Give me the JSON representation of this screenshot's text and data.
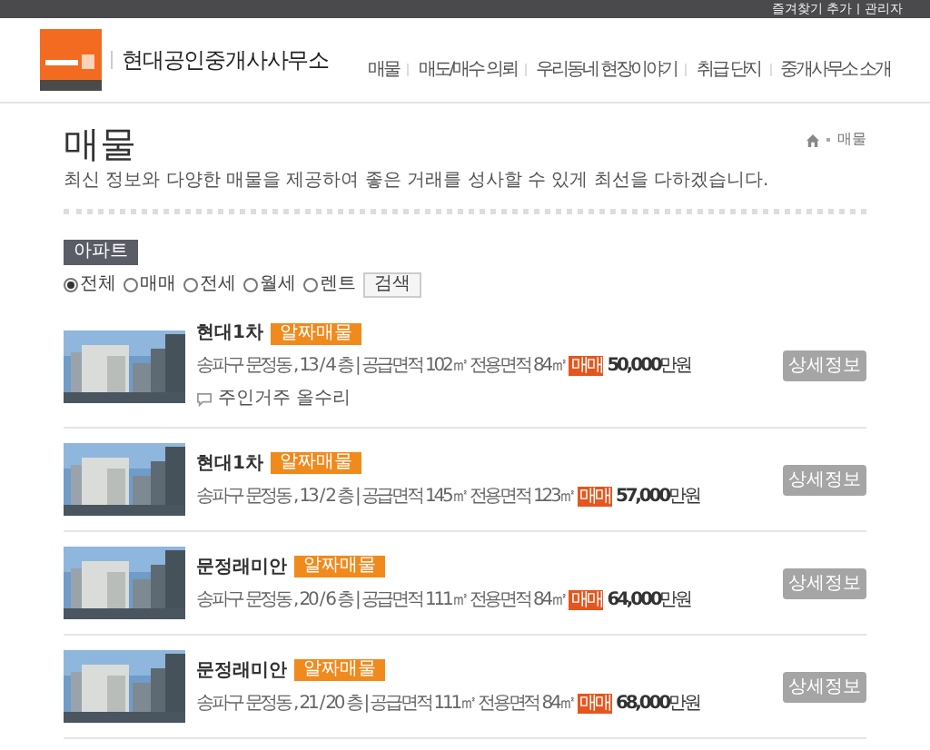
{
  "top_bar": {
    "links": [
      "즐겨찾기 추가",
      "관리자"
    ]
  },
  "header": {
    "site_name": "현대공인중개사사무소",
    "nav": [
      {
        "label": "매물",
        "selected": false
      },
      {
        "label": "매도/매수 의뢰",
        "selected": false
      },
      {
        "label": "우리동네 현장이야기",
        "selected": false
      },
      {
        "label": "취급 단지",
        "selected": false
      },
      {
        "label": "중개사무소 소개",
        "selected": false
      }
    ]
  },
  "page": {
    "title": "매물",
    "breadcrumb": "매물",
    "description": "최신 정보와 다양한 매물을 제공하여 좋은 거래를 성사할 수 있게 최선을 다하겠습니다."
  },
  "filter": {
    "category": "아파트",
    "options": [
      {
        "label": "전체",
        "selected": true
      },
      {
        "label": "매매",
        "selected": false
      },
      {
        "label": "전세",
        "selected": false
      },
      {
        "label": "월세",
        "selected": false
      },
      {
        "label": "렌트",
        "selected": false
      }
    ],
    "search_button": "검색"
  },
  "listings": [
    {
      "kind": "picture",
      "title": "현대1차",
      "badge": "알짜매물",
      "info": "송파구 문정동 , 13 / 4 층 | 공급면적 102㎡ 전용면적 84㎡",
      "deal": "매매",
      "price": "50,000",
      "unit": "만원",
      "note": "주인거주 올수리",
      "button": "상세정보"
    },
    {
      "kind": "picture",
      "title": "현대1차",
      "badge": "알짜매물",
      "info": "송파구 문정동 , 13 / 2 층 | 공급면적 145㎡ 전용면적 123㎡",
      "deal": "매매",
      "price": "57,000",
      "unit": "만원",
      "button": "상세정보"
    },
    {
      "kind": "picture",
      "title": "문정래미안",
      "badge": "알짜매물",
      "info": "송파구 문정동 , 20 / 6 층 | 공급면적 111㎡ 전용면적 84㎡",
      "deal": "매매",
      "price": "64,000",
      "unit": "만원",
      "button": "상세정보"
    },
    {
      "kind": "picture",
      "title": "문정래미안",
      "badge": "알짜매물",
      "info": "송파구 문정동 , 21 / 20 층 | 공급면적 111㎡ 전용면적 84㎡",
      "deal": "매매",
      "price": "68,000",
      "unit": "만원",
      "button": "상세정보"
    }
  ]
}
